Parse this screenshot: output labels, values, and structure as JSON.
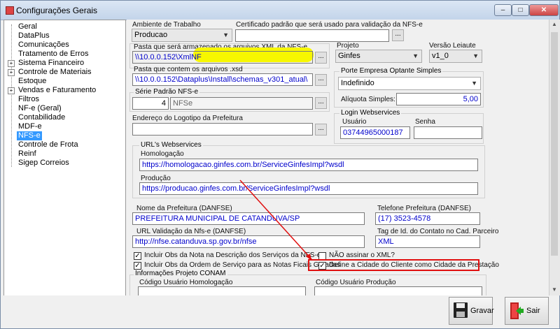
{
  "window": {
    "title": "Configurações Gerais",
    "min_label": "–",
    "max_label": "□",
    "close_label": "✕"
  },
  "tree": {
    "items": [
      {
        "label": "Geral",
        "expandable": false
      },
      {
        "label": "DataPlus",
        "expandable": false
      },
      {
        "label": "Comunicações",
        "expandable": false
      },
      {
        "label": "Tratamento de Erros",
        "expandable": false
      },
      {
        "label": "Sistema Financeiro",
        "expandable": true
      },
      {
        "label": "Controle de Materiais",
        "expandable": true
      },
      {
        "label": "Estoque",
        "expandable": false
      },
      {
        "label": "Vendas e Faturamento",
        "expandable": true
      },
      {
        "label": "Filtros",
        "expandable": false
      },
      {
        "label": "NF-e (Geral)",
        "expandable": false
      },
      {
        "label": "Contabilidade",
        "expandable": false
      },
      {
        "label": "MDF-e",
        "expandable": false
      },
      {
        "label": "NFS-e",
        "expandable": false,
        "selected": true
      },
      {
        "label": "Controle de Frota",
        "expandable": false
      },
      {
        "label": "Reinf",
        "expandable": false
      },
      {
        "label": "Sigep Correios",
        "expandable": false
      }
    ],
    "plus_sign": "+"
  },
  "form": {
    "ambiente_label": "Ambiente de Trabalho",
    "ambiente_value": "Producao",
    "certificado_label": "Certificado padrão que será usado para validação da NFS-e",
    "certificado_value": "",
    "pasta_xml_label": "Pasta que será armazenado os arquivos XML da NFS-e",
    "pasta_xml_value": "\\\\10.0.0.152\\XmlNF",
    "projeto_label": "Projeto",
    "projeto_value": "Ginfes",
    "versao_label": "Versão Leiaute",
    "versao_value": "v1_0",
    "pasta_xsd_label": "Pasta que contem os arquivos .xsd",
    "pasta_xsd_value": "\\\\10.0.0.152\\Dataplus\\Install\\schemas_v301_atual\\",
    "porte_label": "Porte Empresa Optante Simples",
    "porte_value": "Indefinido",
    "aliquota_label": "Alíquota Simples:",
    "aliquota_value": "5,00",
    "serie_label": "Série Padrão NFS-e",
    "serie_num": "4",
    "serie_text": "NFSe",
    "login_label": "Login Webservices",
    "usuario_label": "Usuário",
    "usuario_value": "03744965000187",
    "senha_label": "Senha",
    "senha_value": "",
    "logotipo_label": "Endereço do Logotipo da Prefeitura",
    "logotipo_value": "",
    "urls_label": "URL's Webservices",
    "homologacao_label": "Homologação",
    "homologacao_value": "https://homologacao.ginfes.com.br/ServiceGinfesImpl?wsdl",
    "producao_label": "Produção",
    "producao_value": "https://producao.ginfes.com.br/ServiceGinfesImpl?wsdl",
    "prefeitura_label": "Nome da Prefeitura (DANFSE)",
    "prefeitura_value": "PREFEITURA MUNICIPAL DE CATANDUVA/SP",
    "telefone_label": "Telefone Prefeitura (DANFSE)",
    "telefone_value": "(17) 3523-4578",
    "url_validacao_label": "URL Validação da Nfs-e (DANFSE)",
    "url_validacao_value": "http://nfse.catanduva.sp.gov.br/nfse",
    "tag_label": "Tag de Id. do Contato no Cad. Parceiro",
    "tag_value": "XML",
    "chk_obs_nota": "Incluir Obs da Nota na Descrição dos Serviços da NFS-e",
    "chk_obs_os": "Incluir Obs da Ordem de Serviço para as Notas Ficais Geradas",
    "chk_nao_assinar": "NÃO assinar o XML?",
    "chk_cidade": "Define a Cidade do Cliente como Cidade da Prestação",
    "conam_label": "Informações Projeto CONAM",
    "cod_homolog_label": "Código Usuário Homologação",
    "cod_prod_label": "Código Usuário Produção",
    "ellipsis": "...",
    "check_mark": "✓",
    "dropdown_arrow": "▼"
  },
  "buttons": {
    "gravar": "Gravar",
    "sair": "Sair"
  },
  "colors": {
    "selection": "#3399ff",
    "link_text": "#0000cc",
    "annotation": "#e01010",
    "highlight": "#f7f700"
  }
}
